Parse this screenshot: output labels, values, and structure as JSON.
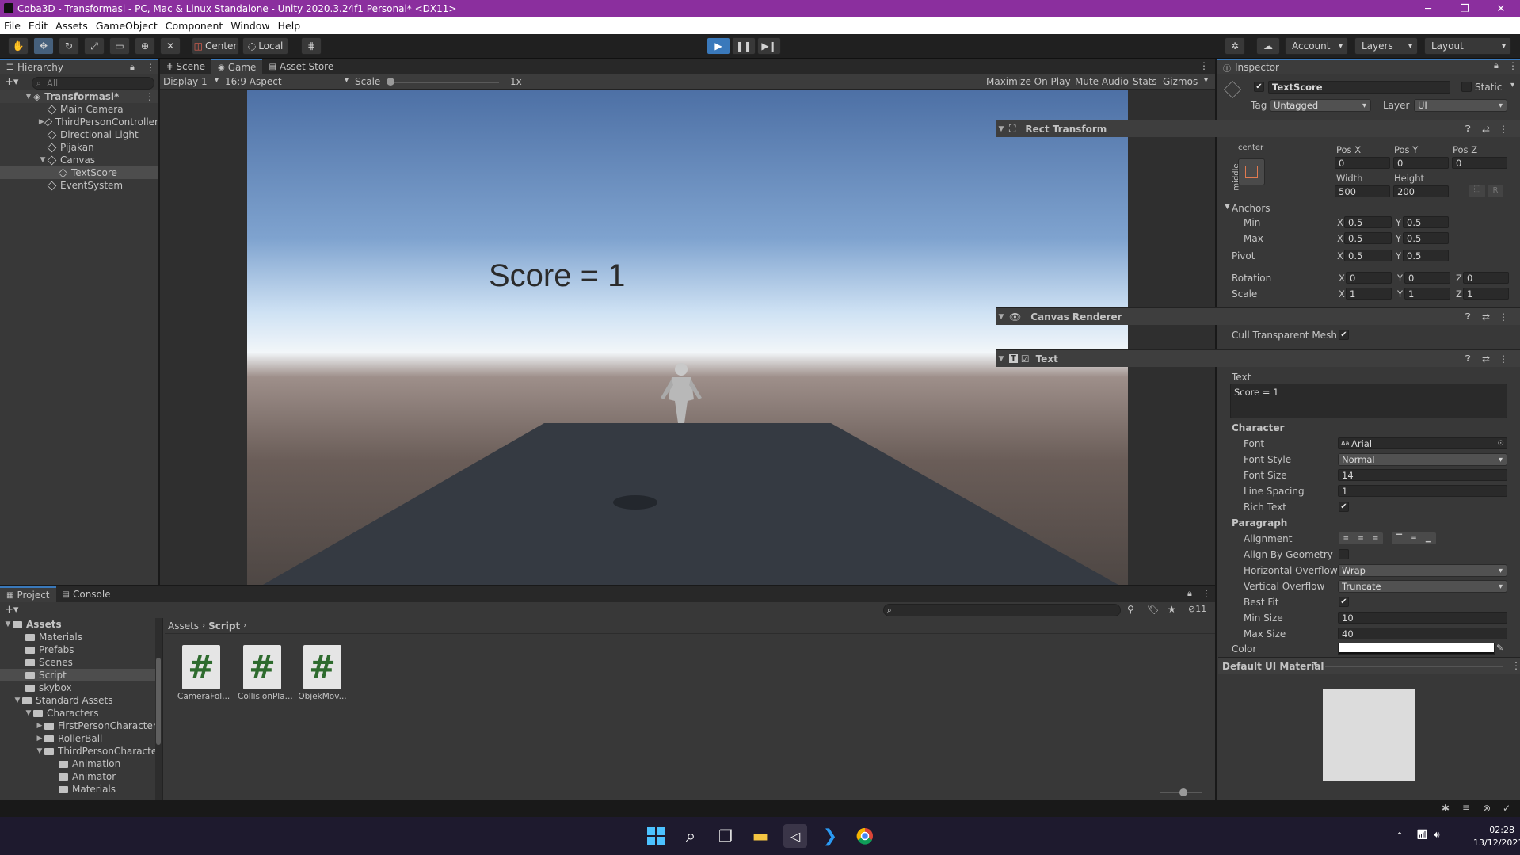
{
  "window": {
    "title": "Coba3D - Transformasi - PC, Mac & Linux Standalone - Unity 2020.3.24f1 Personal* <DX11>",
    "minimize": "─",
    "maximize": "❐",
    "close": "✕"
  },
  "menu": [
    "File",
    "Edit",
    "Assets",
    "GameObject",
    "Component",
    "Window",
    "Help"
  ],
  "toolbar": {
    "center_label": "Center",
    "local_label": "Local",
    "account_label": "Account",
    "layers_label": "Layers",
    "layout_label": "Layout"
  },
  "hierarchy": {
    "tab": "Hierarchy",
    "search_placeholder": "All",
    "scene": "Transformasi*",
    "items": [
      "Main Camera",
      "ThirdPersonController",
      "Directional Light",
      "Pijakan",
      "Canvas",
      "TextScore",
      "EventSystem"
    ]
  },
  "center_tabs": [
    "Scene",
    "Game",
    "Asset Store"
  ],
  "game_toolbar": {
    "display": "Display 1",
    "aspect": "16:9 Aspect",
    "scale_label": "Scale",
    "scale_value": "1x",
    "maximize": "Maximize On Play",
    "mute": "Mute Audio",
    "stats": "Stats",
    "gizmos": "Gizmos"
  },
  "game_view": {
    "score_text": "Score = 1"
  },
  "project": {
    "tabs": [
      "Project",
      "Console"
    ],
    "tree": [
      "Assets",
      "Materials",
      "Prefabs",
      "Scenes",
      "Script",
      "skybox",
      "Standard Assets",
      "Characters",
      "FirstPersonCharacter",
      "RollerBall",
      "ThirdPersonCharacter",
      "Animation",
      "Animator",
      "Materials"
    ],
    "breadcrumb": [
      "Assets",
      "Script"
    ],
    "hidden_count": "11",
    "files": [
      "CameraFol...",
      "CollisionPla...",
      "ObjekMov..."
    ],
    "file_icon_glyph": "#"
  },
  "inspector": {
    "tab": "Inspector",
    "object_name": "TextScore",
    "static_label": "Static",
    "tag_label": "Tag",
    "tag_value": "Untagged",
    "layer_label": "Layer",
    "layer_value": "UI",
    "rect_transform": {
      "title": "Rect Transform",
      "anchor_h": "center",
      "anchor_v": "middle",
      "posx_label": "Pos X",
      "posy_label": "Pos Y",
      "posz_label": "Pos Z",
      "posx": "0",
      "posy": "0",
      "posz": "0",
      "width_label": "Width",
      "height_label": "Height",
      "width": "500",
      "height": "200",
      "r_btn": "R",
      "anchors_label": "Anchors",
      "min_label": "Min",
      "max_label": "Max",
      "min_x": "0.5",
      "min_y": "0.5",
      "max_x": "0.5",
      "max_y": "0.5",
      "pivot_label": "Pivot",
      "pivot_x": "0.5",
      "pivot_y": "0.5",
      "rotation_label": "Rotation",
      "rot_x": "0",
      "rot_y": "0",
      "rot_z": "0",
      "scale_label": "Scale",
      "scale_x": "1",
      "scale_y": "1",
      "scale_z": "1",
      "x": "X",
      "y": "Y",
      "z": "Z"
    },
    "canvas_renderer": {
      "title": "Canvas Renderer",
      "cull_label": "Cull Transparent Mesh"
    },
    "text_component": {
      "title": "Text",
      "text_label": "Text",
      "text_value": "Score = 1",
      "character_label": "Character",
      "font_label": "Font",
      "font_value": "Arial",
      "font_style_label": "Font Style",
      "font_style_value": "Normal",
      "font_size_label": "Font Size",
      "font_size_value": "14",
      "line_spacing_label": "Line Spacing",
      "line_spacing_value": "1",
      "rich_text_label": "Rich Text",
      "paragraph_label": "Paragraph",
      "alignment_label": "Alignment",
      "align_geometry_label": "Align By Geometry",
      "h_overflow_label": "Horizontal Overflow",
      "h_overflow_value": "Wrap",
      "v_overflow_label": "Vertical Overflow",
      "v_overflow_value": "Truncate",
      "best_fit_label": "Best Fit",
      "min_size_label": "Min Size",
      "min_size_value": "10",
      "max_size_label": "Max Size",
      "max_size_value": "40",
      "color_label": "Color"
    },
    "material_label": "Default UI Material"
  },
  "taskbar": {
    "time": "02:28",
    "date": "13/12/2021"
  },
  "colors": {
    "accent": "#3a79bb",
    "title_bar": "#8b2f9e",
    "panel": "#383838",
    "script_icon_hash": "#2e6b2e"
  }
}
